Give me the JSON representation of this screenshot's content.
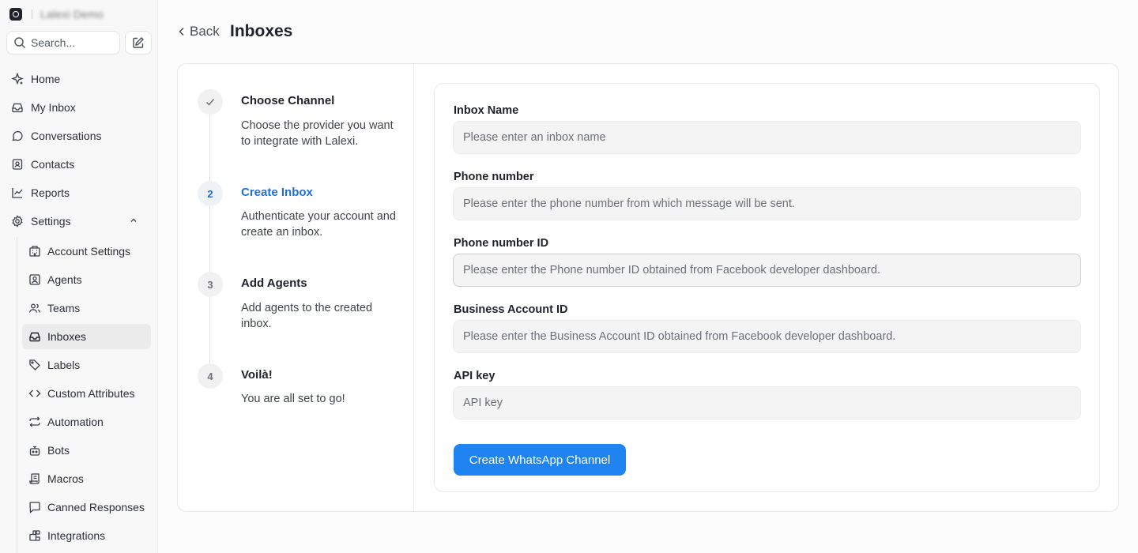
{
  "brand": {
    "name": "Lalexi Demo",
    "logo_icon": "chat-bubble-logo-icon"
  },
  "search": {
    "placeholder": "Search..."
  },
  "nav": {
    "items": [
      {
        "label": "Home",
        "icon": "sparkle-icon"
      },
      {
        "label": "My Inbox",
        "icon": "inbox-icon"
      },
      {
        "label": "Conversations",
        "icon": "chat-bubble-icon"
      },
      {
        "label": "Contacts",
        "icon": "contact-card-icon"
      },
      {
        "label": "Reports",
        "icon": "line-chart-icon"
      },
      {
        "label": "Settings",
        "icon": "gear-icon"
      }
    ],
    "settings_sub": [
      {
        "label": "Account Settings",
        "icon": "building-icon"
      },
      {
        "label": "Agents",
        "icon": "user-square-icon"
      },
      {
        "label": "Teams",
        "icon": "users-icon"
      },
      {
        "label": "Inboxes",
        "icon": "inbox-icon",
        "active": true
      },
      {
        "label": "Labels",
        "icon": "tag-icon"
      },
      {
        "label": "Custom Attributes",
        "icon": "code-icon"
      },
      {
        "label": "Automation",
        "icon": "repeat-icon"
      },
      {
        "label": "Bots",
        "icon": "bot-icon"
      },
      {
        "label": "Macros",
        "icon": "scroll-icon"
      },
      {
        "label": "Canned Responses",
        "icon": "message-square-icon"
      },
      {
        "label": "Integrations",
        "icon": "blocks-icon"
      }
    ]
  },
  "header": {
    "back_label": "Back",
    "title": "Inboxes"
  },
  "steps": [
    {
      "number": "",
      "title": "Choose Channel",
      "description": "Choose the provider you want to integrate with Lalexi.",
      "state": "done"
    },
    {
      "number": "2",
      "title": "Create Inbox",
      "description": "Authenticate your account and create an inbox.",
      "state": "current"
    },
    {
      "number": "3",
      "title": "Add Agents",
      "description": "Add agents to the created inbox.",
      "state": "pending"
    },
    {
      "number": "4",
      "title": "Voilà!",
      "description": "You are all set to go!",
      "state": "pending"
    }
  ],
  "form": {
    "fields": [
      {
        "label": "Inbox Name",
        "placeholder": "Please enter an inbox name",
        "value": ""
      },
      {
        "label": "Phone number",
        "placeholder": "Please enter the phone number from which message will be sent.",
        "value": ""
      },
      {
        "label": "Phone number ID",
        "placeholder": "Please enter the Phone number ID obtained from Facebook developer dashboard.",
        "value": ""
      },
      {
        "label": "Business Account ID",
        "placeholder": "Please enter the Business Account ID obtained from Facebook developer dashboard.",
        "value": ""
      },
      {
        "label": "API key",
        "placeholder": "API key",
        "value": ""
      }
    ],
    "submit_label": "Create WhatsApp Channel"
  },
  "colors": {
    "accent": "#1f83f2",
    "active_step": "#1f6fd6"
  }
}
